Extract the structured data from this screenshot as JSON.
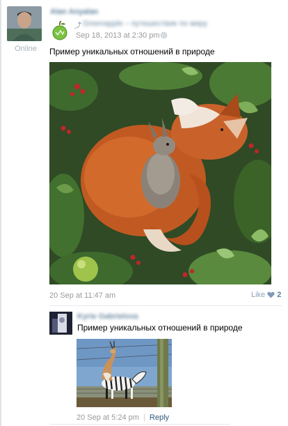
{
  "post": {
    "author_name": "Alan Anyalan",
    "online_status": "Online",
    "repost_mark": "⤴",
    "group_name": "Greenapple – путешествие по миру",
    "date": "Sep 18, 2013 at 2:30 pm",
    "text": "Пример уникальных отношений в природе",
    "footer_date": "20 Sep at 11:47 am",
    "like_label": "Like",
    "like_count": "2"
  },
  "comment": {
    "author_name": "Kyrie Gabrielova",
    "text": "Пример уникальных отношений в природе",
    "date": "20 Sep at 5:24 pm",
    "separator": "|",
    "reply_label": "Reply"
  },
  "icons": {
    "gear": "gear-icon",
    "heart": "heart-icon",
    "group": "green-apple-icon"
  },
  "colors": {
    "link": "#2b587a",
    "muted": "#999999",
    "like": "#5c7fa3"
  }
}
